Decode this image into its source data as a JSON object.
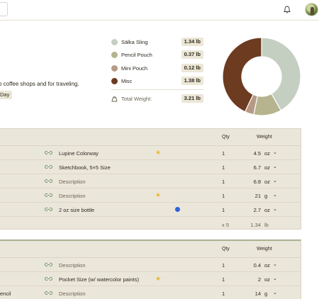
{
  "summary": {
    "description": "o coffee shops and for traveling.",
    "tag": "Day",
    "legend": [
      {
        "label": "Sälka Sling",
        "weight": "1.34 lb",
        "color": "#c4cfc2"
      },
      {
        "label": "Pencil Pouch",
        "weight": "0.37 lb",
        "color": "#b5b48e"
      },
      {
        "label": "Mini Pouch",
        "weight": "0.12 lb",
        "color": "#b69a85"
      },
      {
        "label": "Misc",
        "weight": "1.38 lb",
        "color": "#6c3b20"
      }
    ],
    "total_label": "Total Weight:",
    "total_value": "3.21 lb"
  },
  "chart_data": {
    "type": "pie",
    "categories": [
      "Sälka Sling",
      "Pencil Pouch",
      "Mini Pouch",
      "Misc"
    ],
    "values": [
      1.34,
      0.37,
      0.12,
      1.38
    ],
    "colors": [
      "#c4cfc2",
      "#b5b48e",
      "#b69a85",
      "#6c3b20"
    ]
  },
  "panel1": {
    "qty_header": "Qty",
    "weight_header": "Weight",
    "rows": [
      {
        "name": "Lupine Colorway",
        "qty": "1",
        "weight": "4.5",
        "unit": "oz"
      },
      {
        "name": "Sketchbook, 5×5 Size",
        "qty": "1",
        "weight": "6.7",
        "unit": "oz"
      },
      {
        "name": "Description",
        "qty": "1",
        "weight": "6.8",
        "unit": "oz"
      },
      {
        "name": "Description",
        "qty": "1",
        "weight": "21",
        "unit": "g"
      },
      {
        "name": "2 oz size bottle",
        "qty": "1",
        "weight": "2.7",
        "unit": "oz"
      }
    ],
    "footer_count": "x 5",
    "footer_weight": "1.34",
    "footer_unit": "lb"
  },
  "panel2": {
    "qty_header": "Qty",
    "weight_header": "Weight",
    "rows": [
      {
        "name": "Description",
        "qty": "1",
        "weight": "0.4",
        "unit": "oz"
      },
      {
        "name": "Pocket Size (w/ watercolor paints)",
        "qty": "1",
        "weight": "2",
        "unit": "oz"
      },
      {
        "name": "Description",
        "qty": "1",
        "weight": "14",
        "unit": "g",
        "left_label": "encil"
      }
    ]
  }
}
